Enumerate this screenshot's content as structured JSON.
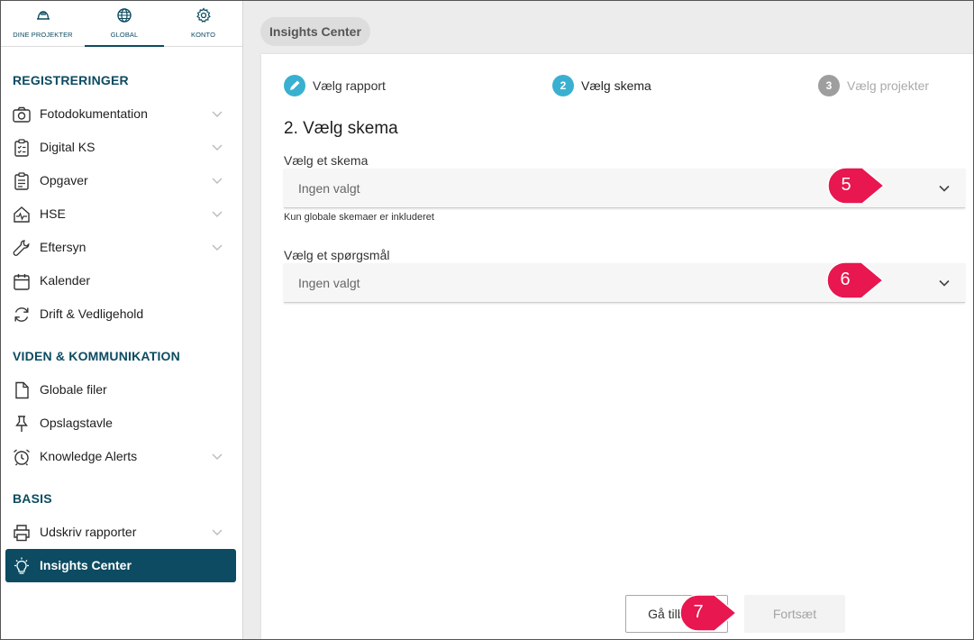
{
  "topnav": {
    "tabs": [
      {
        "label": "DINE PROJEKTER",
        "icon": "hard-hat-icon"
      },
      {
        "label": "GLOBAL",
        "icon": "globe-icon"
      },
      {
        "label": "KONTO",
        "icon": "gear-icon"
      }
    ]
  },
  "sidebar": {
    "sections": [
      {
        "title": "REGISTRERINGER"
      },
      {
        "title": "VIDEN & KOMMUNIKATION"
      },
      {
        "title": "BASIS"
      }
    ],
    "items": [
      {
        "label": "Fotodokumentation",
        "icon": "camera-icon"
      },
      {
        "label": "Digital KS",
        "icon": "clipboard-check-icon"
      },
      {
        "label": "Opgaver",
        "icon": "clipboard-list-icon"
      },
      {
        "label": "HSE",
        "icon": "house-heartbeat-icon"
      },
      {
        "label": "Eftersyn",
        "icon": "wrench-icon"
      },
      {
        "label": "Kalender",
        "icon": "calendar-icon"
      },
      {
        "label": "Drift & Vedligehold",
        "icon": "refresh-icon"
      },
      {
        "label": "Globale filer",
        "icon": "file-icon"
      },
      {
        "label": "Opslagstavle",
        "icon": "pushpin-icon"
      },
      {
        "label": "Knowledge Alerts",
        "icon": "alarm-clock-icon"
      },
      {
        "label": "Udskriv rapporter",
        "icon": "printer-icon"
      },
      {
        "label": "Insights Center",
        "icon": "lightbulb-icon"
      }
    ]
  },
  "breadcrumb": {
    "label": "Insights Center"
  },
  "stepper": {
    "steps": [
      {
        "marker": "",
        "label": "Vælg rapport",
        "state": "done"
      },
      {
        "marker": "2",
        "label": "Vælg skema",
        "state": "active"
      },
      {
        "marker": "3",
        "label": "Vælg projekter",
        "state": "pending"
      }
    ]
  },
  "form": {
    "heading": "2. Vælg skema",
    "schema_label": "Vælg et skema",
    "schema_value": "Ingen valgt",
    "schema_hint": "Kun globale skemaer er inkluderet",
    "question_label": "Vælg et spørgsmål",
    "question_value": "Ingen valgt"
  },
  "buttons": {
    "back": "Gå tilbage",
    "next": "Fortsæt"
  },
  "callouts": [
    "5",
    "6",
    "7"
  ],
  "colors": {
    "brand": "#0c4b61",
    "step_active": "#3ab0d0",
    "step_pending": "#9e9e9e",
    "callout": "#e8174f"
  }
}
